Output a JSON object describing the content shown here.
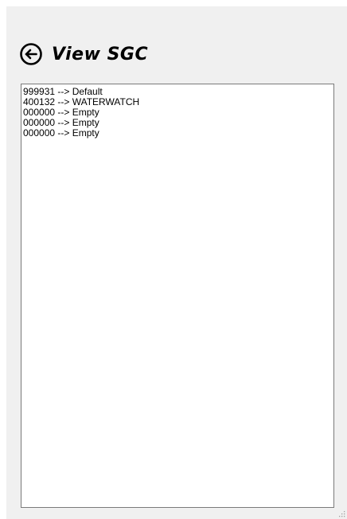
{
  "header": {
    "title": "View SGC",
    "back_icon": "back-arrow-circle-icon"
  },
  "list": {
    "items": [
      "999931 --> Default",
      "400132 --> WATERWATCH",
      "000000 --> Empty",
      "000000 --> Empty",
      "000000 --> Empty"
    ]
  },
  "colors": {
    "window_background": "#f0f0f0",
    "list_background": "#ffffff",
    "list_border": "#7a7a7a",
    "text": "#000000"
  }
}
